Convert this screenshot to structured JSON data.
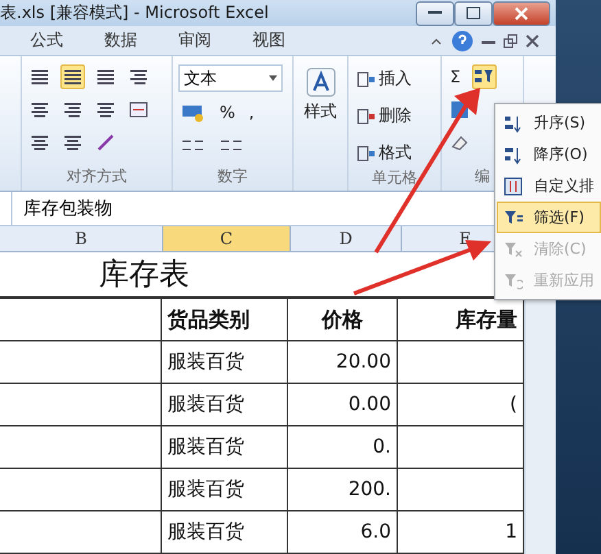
{
  "window": {
    "title": "表.xls  [兼容模式]  -  Microsoft Excel"
  },
  "tabs": [
    {
      "label": "公式",
      "selected": false
    },
    {
      "label": "数据",
      "selected": false
    },
    {
      "label": "审阅",
      "selected": false
    },
    {
      "label": "视图",
      "selected": false
    }
  ],
  "ribbon": {
    "align_buttons": [
      {
        "selected": false
      },
      {
        "selected": true
      },
      {
        "selected": false
      }
    ],
    "number_format": "文本",
    "percent": "%",
    "comma": ",",
    "styles": "样式",
    "cells": [
      "插入",
      "删除",
      "格式"
    ],
    "sum": "Σ",
    "sort_filter_selected": true,
    "groups": [
      "对齐方式",
      "数字",
      "单元格",
      "编"
    ]
  },
  "formula_bar": {
    "value": "库存包装物"
  },
  "columns": [
    {
      "label": "B",
      "selected": false
    },
    {
      "label": "C",
      "selected": true
    },
    {
      "label": "D",
      "selected": false
    },
    {
      "label": "E",
      "selected": false
    }
  ],
  "sheet": {
    "title": "库存表",
    "headers": [
      "货品类别",
      "价格",
      "库存量"
    ],
    "rows": [
      {
        "category": "服装百货",
        "price": "20.00"
      },
      {
        "category": "服装百货",
        "price": "0.00",
        "stock": "("
      },
      {
        "category": "服装百货",
        "price": "0."
      },
      {
        "category": "服装百货",
        "price": "200."
      },
      {
        "category": "服装百货",
        "price": "6.0",
        "stock": "1"
      }
    ]
  },
  "menu": {
    "items": [
      {
        "kind": "sort-asc",
        "label": "升序(S)",
        "selected": false,
        "disabled": false
      },
      {
        "kind": "sort-desc",
        "label": "降序(O)",
        "selected": false,
        "disabled": false
      },
      {
        "kind": "custom-sort",
        "label": "自定义排",
        "selected": false,
        "disabled": false
      },
      {
        "kind": "filter",
        "label": "筛选(F)",
        "selected": true,
        "disabled": false
      },
      {
        "kind": "clear",
        "label": "清除(C)",
        "selected": false,
        "disabled": true
      },
      {
        "kind": "reapply",
        "label": "重新应用",
        "selected": false,
        "disabled": true
      }
    ]
  }
}
